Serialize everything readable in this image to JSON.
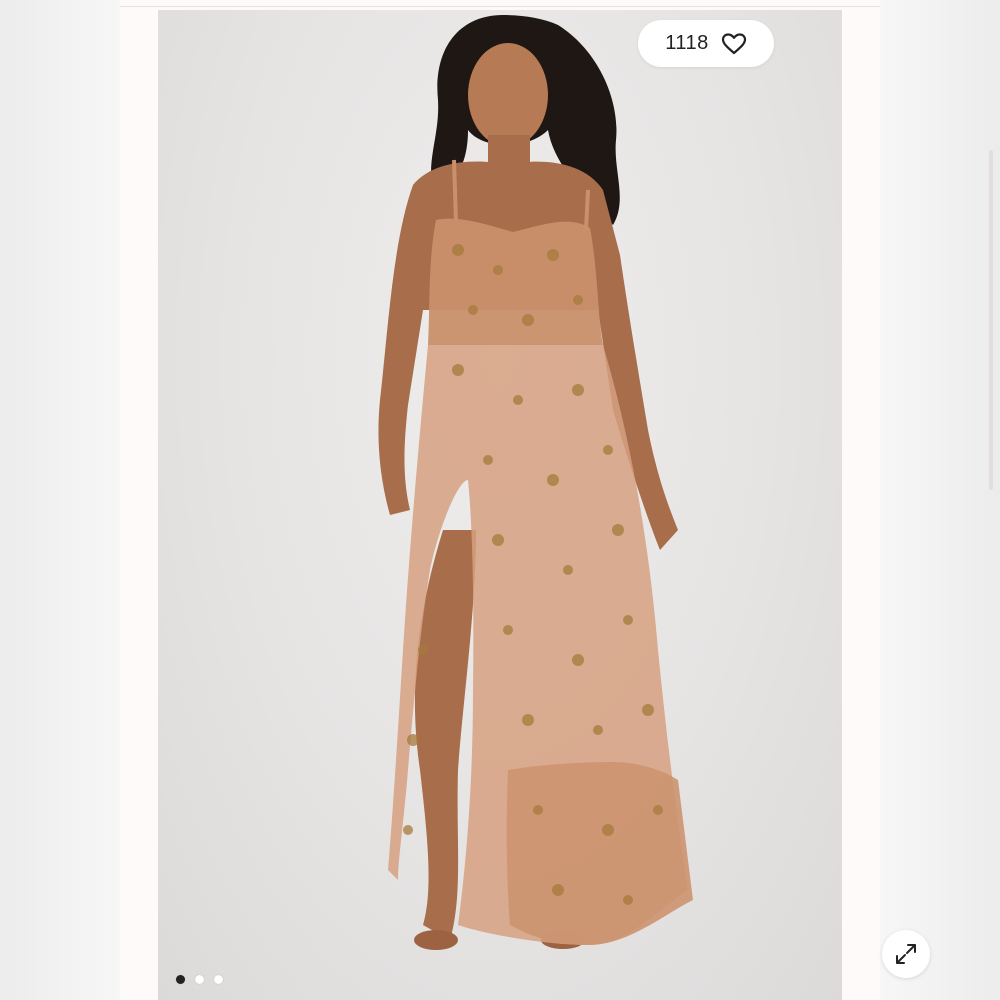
{
  "like": {
    "count": "1118"
  },
  "icons": {
    "heart": "heart-icon",
    "expand": "expand-icon"
  },
  "carousel": {
    "total": 3,
    "active": 1
  },
  "colors": {
    "dress": "#c9906c",
    "dress_light": "#dca889",
    "embroidery": "#a67a3a",
    "skin": "#a86d4b",
    "hair": "#1e1714",
    "background": "#e6e4e3"
  }
}
